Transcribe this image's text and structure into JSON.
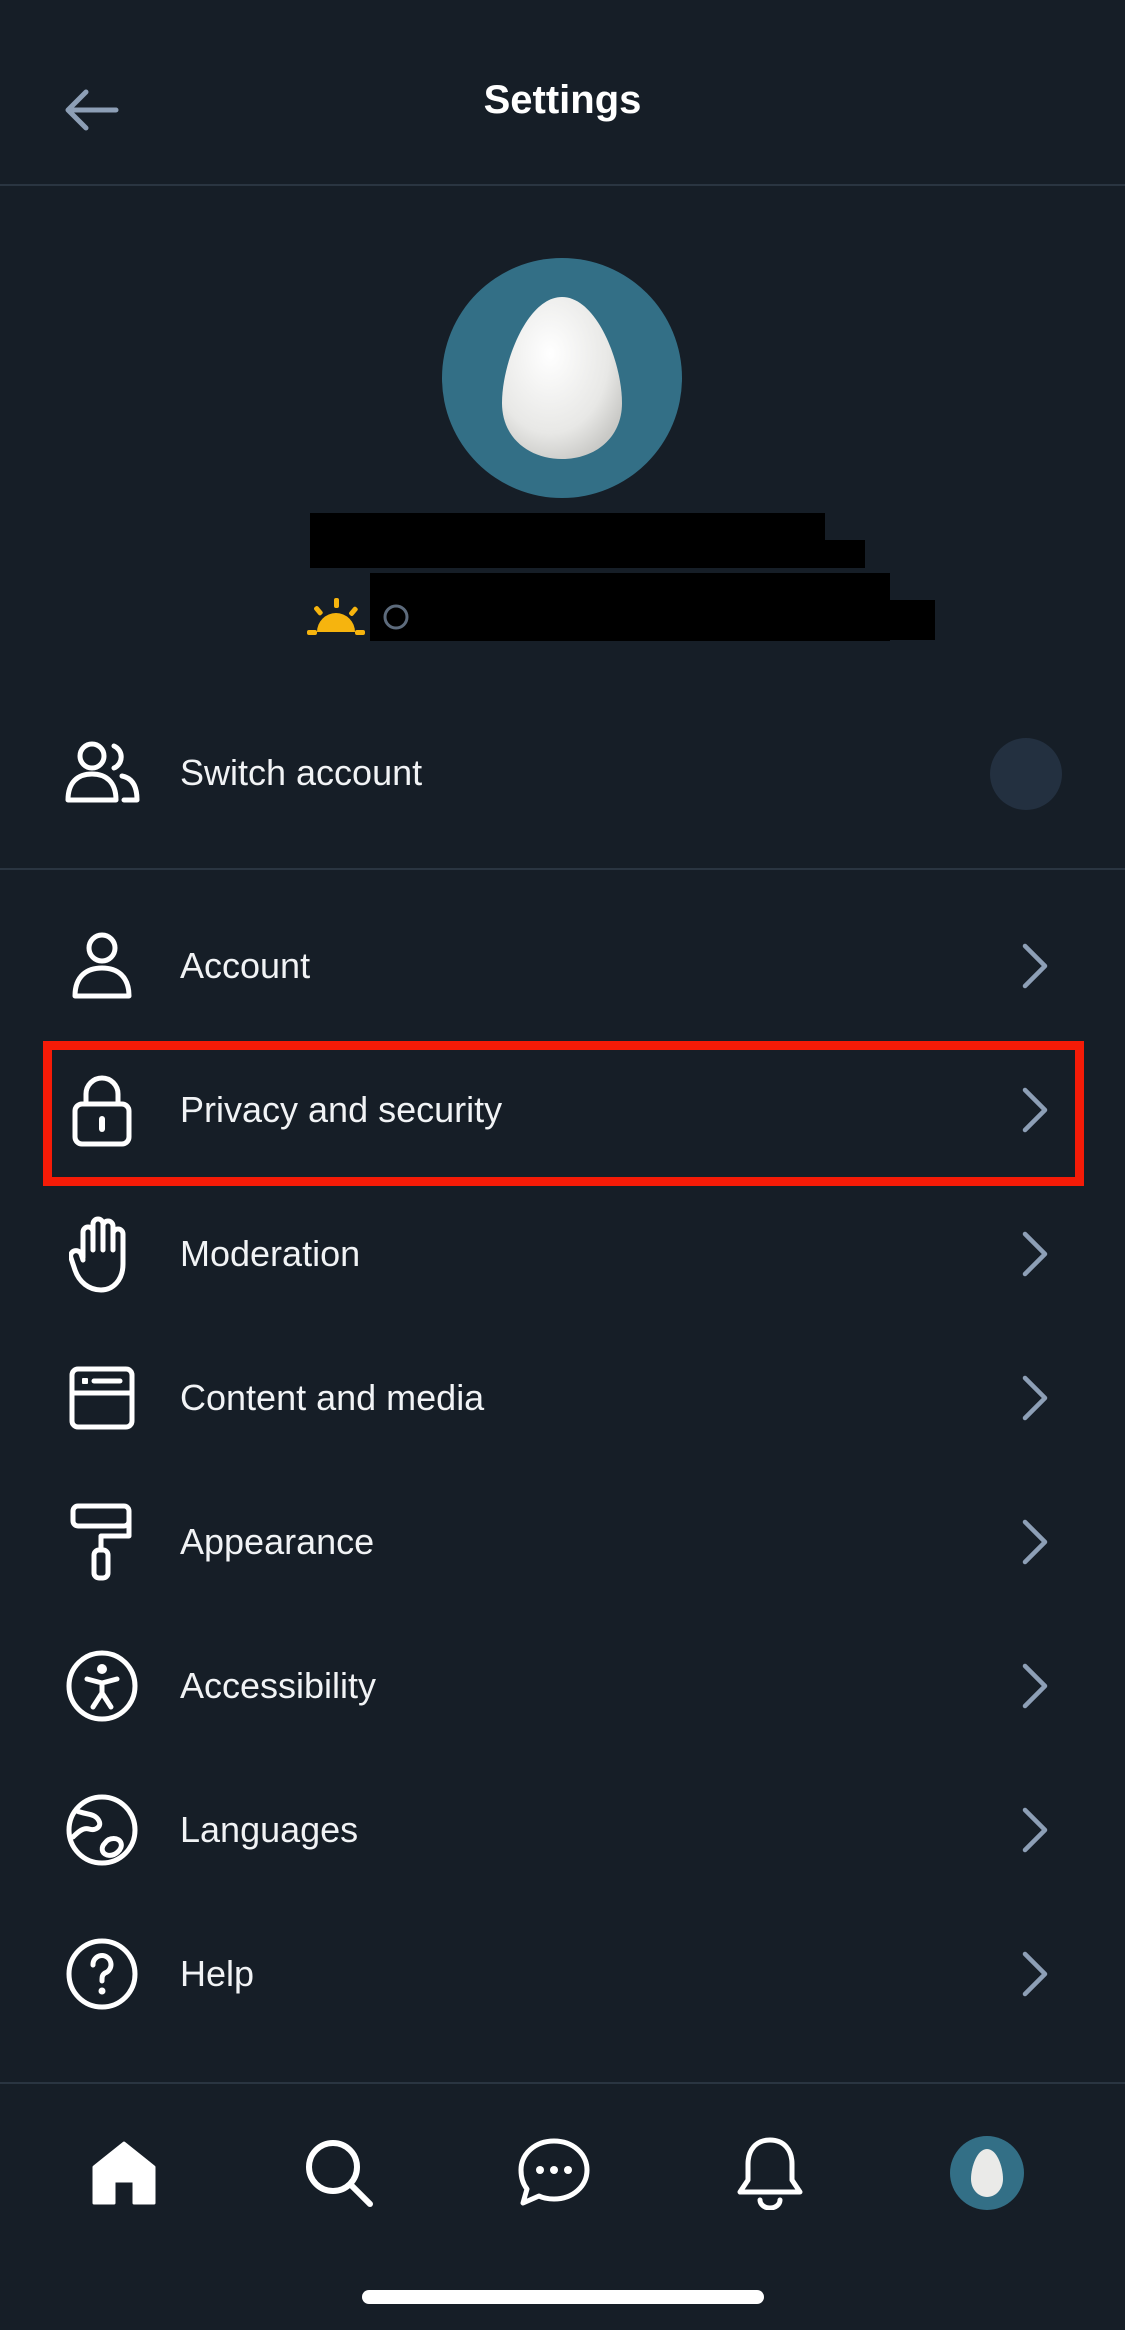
{
  "header": {
    "title": "Settings",
    "back_icon": "arrow-left-icon"
  },
  "profile": {
    "avatar_icon": "egg-avatar-icon",
    "status_icon": "sunrise-icon"
  },
  "switch_account": {
    "label": "Switch account",
    "icon": "users-icon"
  },
  "menu": {
    "items": [
      {
        "label": "Account",
        "icon": "person-icon"
      },
      {
        "label": "Privacy and security",
        "icon": "lock-icon"
      },
      {
        "label": "Moderation",
        "icon": "hand-icon"
      },
      {
        "label": "Content and media",
        "icon": "browser-window-icon"
      },
      {
        "label": "Appearance",
        "icon": "paint-roller-icon"
      },
      {
        "label": "Accessibility",
        "icon": "accessibility-icon"
      },
      {
        "label": "Languages",
        "icon": "globe-icon"
      },
      {
        "label": "Help",
        "icon": "question-circle-icon"
      }
    ]
  },
  "bottom_nav": {
    "tabs": [
      "home-icon",
      "search-icon",
      "chat-bubble-icon",
      "bell-icon",
      "profile-avatar-icon"
    ]
  },
  "colors": {
    "background": "#161e27",
    "divider": "#2a3541",
    "highlight": "#f51b07",
    "chevron": "#8d9fb6",
    "avatar": "#336f86",
    "sun": "#f6b40e"
  }
}
